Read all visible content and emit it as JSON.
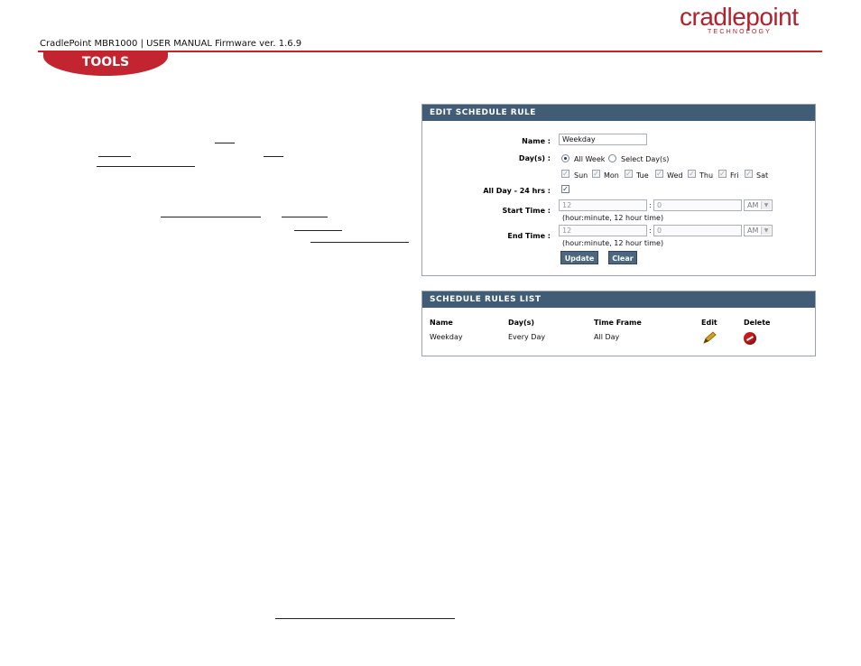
{
  "header": {
    "logo_word": "cradlepoint",
    "logo_tagline": "TECHNOLOGY",
    "doc_title": "CradlePoint MBR1000 | USER MANUAL Firmware ver. 1.6.9",
    "section_tab": "TOOLS"
  },
  "colors": {
    "brand_red": "#c22530",
    "panel_header": "#405c77"
  },
  "edit_rule": {
    "title": "EDIT SCHEDULE RULE",
    "name_label": "Name :",
    "name_value": "Weekday",
    "days_label": "Day(s) :",
    "all_week": "All Week",
    "select_days": "Select Day(s)",
    "days": [
      "Sun",
      "Mon",
      "Tue",
      "Wed",
      "Thu",
      "Fri",
      "Sat"
    ],
    "all_day_label": "All Day - 24 hrs :",
    "start_label": "Start Time :",
    "end_label": "End Time :",
    "start_hour": "12",
    "start_min": "0",
    "end_hour": "12",
    "end_min": "0",
    "ampm": "AM",
    "time_colon": ":",
    "time_hint": "(hour:minute, 12 hour time)",
    "update_btn": "Update",
    "clear_btn": "Clear"
  },
  "rules_list": {
    "title": "SCHEDULE RULES LIST",
    "columns": [
      "Name",
      "Day(s)",
      "Time Frame",
      "Edit",
      "Delete"
    ],
    "rows": [
      {
        "name": "Weekday",
        "days": "Every Day",
        "time_frame": "All Day"
      }
    ]
  }
}
